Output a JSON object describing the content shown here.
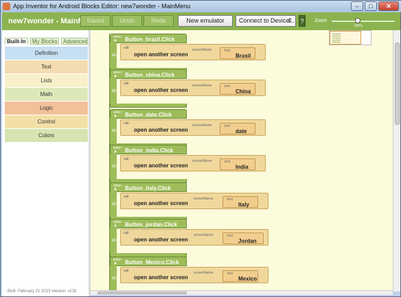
{
  "window": {
    "title": "App Inventor for Android Blocks Editor: new7wonder - MainMenu"
  },
  "toolbar": {
    "project_title": "new7wonder - MainM...",
    "saved": "Saved",
    "undo": "Undo",
    "redo": "Redo",
    "new_emulator": "New emulator",
    "connect": "Connect to Device... ",
    "help": "?",
    "zoom_label": "Zoom",
    "zoom_value": "100%"
  },
  "sidebar": {
    "tabs": [
      "Built-In",
      "My Blocks",
      "Advanced"
    ],
    "categories": [
      {
        "label": "Definition",
        "color": "#c7dff2"
      },
      {
        "label": "Text",
        "color": "#f4dcb0"
      },
      {
        "label": "Lists",
        "color": "#f7f0c8"
      },
      {
        "label": "Math",
        "color": "#dde8b8"
      },
      {
        "label": "Logic",
        "color": "#f2c09a"
      },
      {
        "label": "Control",
        "color": "#f2e0a8"
      },
      {
        "label": "Colors",
        "color": "#d6e4b0"
      }
    ],
    "build_info": "Built: February 21 2013 Version: v133"
  },
  "blocks": [
    {
      "event": "Button_brazil.Click",
      "call": "open another screen",
      "param": "screenName",
      "text": "Brasil"
    },
    {
      "event": "Button_china.Click",
      "call": "open another screen",
      "param": "screenName",
      "text": "China"
    },
    {
      "event": "Button_date.Click",
      "call": "open another screen",
      "param": "screenName",
      "text": "date"
    },
    {
      "event": "Button_india.Click",
      "call": "open another screen",
      "param": "screenName",
      "text": "India"
    },
    {
      "event": "Button_italy.Click",
      "call": "open another screen",
      "param": "screenName",
      "text": "Italy"
    },
    {
      "event": "Button_jordan.Click",
      "call": "open another screen",
      "param": "screenName",
      "text": "Jordan"
    },
    {
      "event": "Button_Mexico.Click",
      "call": "open another screen",
      "param": "screenName",
      "text": "Mexico"
    }
  ],
  "block_labels": {
    "when": "when",
    "do": "do",
    "call": "call",
    "text": "text"
  }
}
